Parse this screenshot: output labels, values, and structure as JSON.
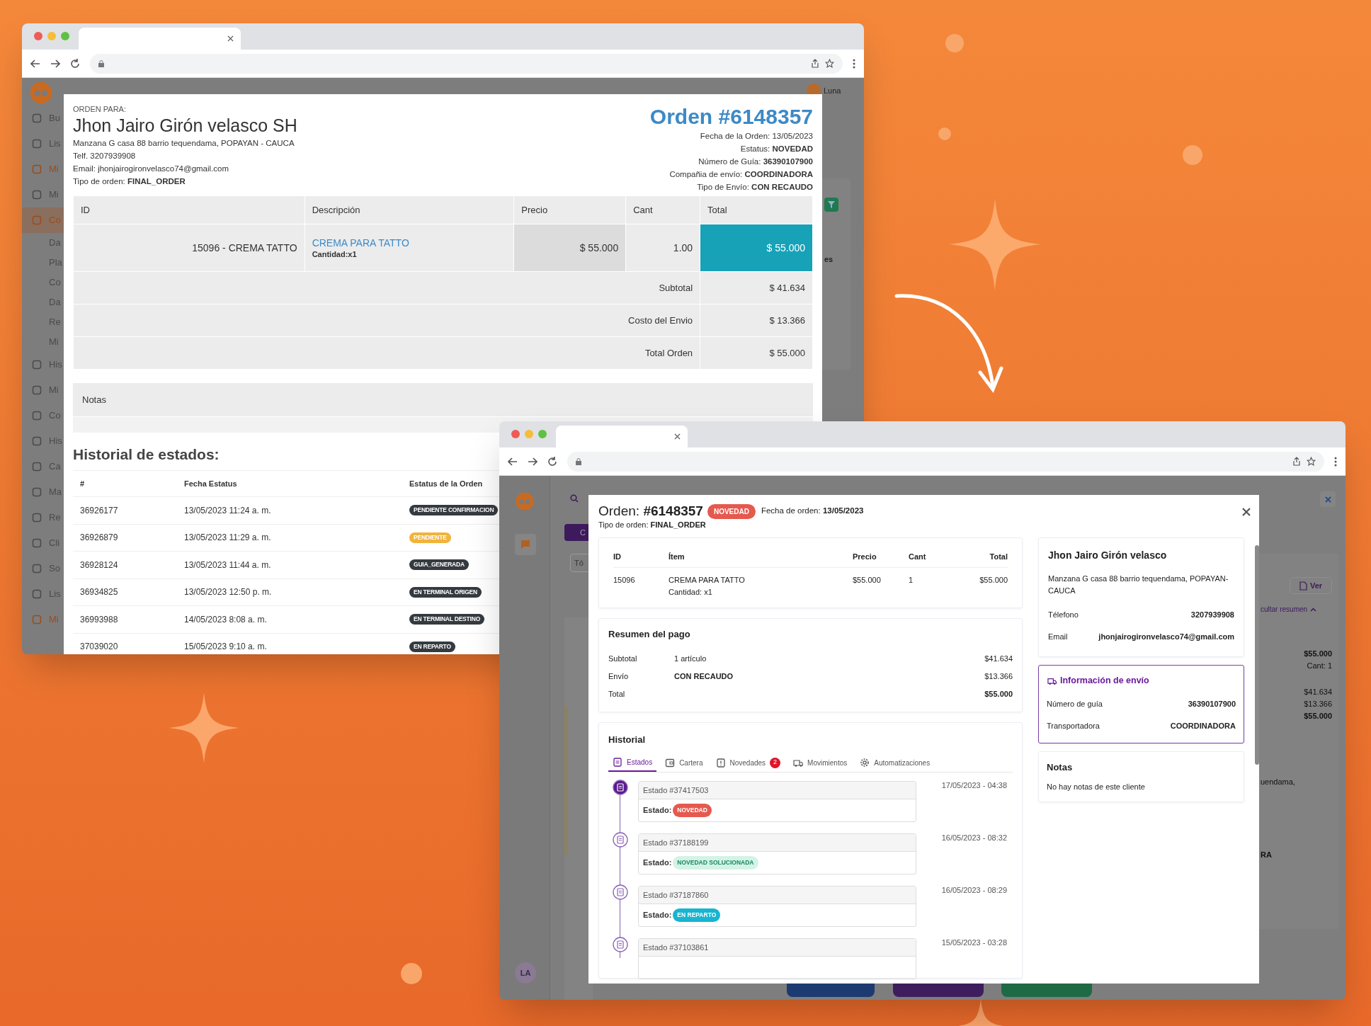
{
  "left_window": {
    "sidebar": [
      {
        "label": "Bu",
        "kind": "item",
        "color": "#4a4a4a",
        "selected": false
      },
      {
        "label": "Lis",
        "kind": "item",
        "color": "#4a4a4a",
        "selected": false
      },
      {
        "label": "Mi",
        "kind": "item",
        "color": "#9a4d1c",
        "selected": false
      },
      {
        "label": "Mi",
        "kind": "item",
        "color": "#4a4a4a",
        "selected": false
      },
      {
        "label": "Co",
        "kind": "item",
        "color": "#9a4d1c",
        "selected": true
      },
      {
        "label": "Da",
        "kind": "sub",
        "color": "#4a4a4a",
        "selected": false
      },
      {
        "label": "Pla",
        "kind": "sub",
        "color": "#4a4a4a",
        "selected": false
      },
      {
        "label": "Co",
        "kind": "sub",
        "color": "#4a4a4a",
        "selected": false
      },
      {
        "label": "Da",
        "kind": "sub",
        "color": "#4a4a4a",
        "selected": false
      },
      {
        "label": "Re",
        "kind": "sub",
        "color": "#4a4a4a",
        "selected": false
      },
      {
        "label": "Mi",
        "kind": "sub",
        "color": "#4a4a4a",
        "selected": false
      },
      {
        "label": "His",
        "kind": "item",
        "color": "#4a4a4a",
        "selected": false
      },
      {
        "label": "Mi",
        "kind": "item",
        "color": "#4a4a4a",
        "selected": false
      },
      {
        "label": "Co",
        "kind": "item",
        "color": "#4a4a4a",
        "selected": false
      },
      {
        "label": "His",
        "kind": "item",
        "color": "#4a4a4a",
        "selected": false
      },
      {
        "label": "Ca",
        "kind": "item",
        "color": "#4a4a4a",
        "selected": false
      },
      {
        "label": "Ma",
        "kind": "item",
        "color": "#4a4a4a",
        "selected": false
      },
      {
        "label": "Re",
        "kind": "item",
        "color": "#4a4a4a",
        "selected": false
      },
      {
        "label": "Cli",
        "kind": "item",
        "color": "#4a4a4a",
        "selected": false
      },
      {
        "label": "So",
        "kind": "item",
        "color": "#4a4a4a",
        "selected": false
      },
      {
        "label": "Lis",
        "kind": "item",
        "color": "#4a4a4a",
        "selected": false
      },
      {
        "label": "Mi",
        "kind": "item",
        "color": "#9a4d1c",
        "selected": false
      }
    ],
    "user": "Luna",
    "side_fragment": "es",
    "invoice": {
      "heading_label": "ORDEN PARA:",
      "customer": "Jhon Jairo Girón velasco SH",
      "address": "Manzana G casa 88 barrio tequendama, POPAYAN - CAUCA",
      "phone": "Telf. 3207939908",
      "email": "Email: jhonjairogironvelasco74@gmail.com",
      "order_type": "Tipo de orden: **FINAL_ORDER**",
      "title": "Orden #6148357",
      "details": [
        "Fecha de la Orden: 13/05/2023",
        "Estatus: **NOVEDAD**",
        "Número de Guía: **36390107900**",
        "Compañia de envío: **COORDINADORA**",
        "Tipo de Envío: **CON RECAUDO**"
      ],
      "columns": [
        "ID",
        "Descripción",
        "Precio",
        "Cant",
        "Total"
      ],
      "rows": [
        {
          "id": "15096 - CREMA TATTO",
          "description": "CREMA PARA TATTO",
          "note": "Cantidad:x1",
          "price": "$ 55.000",
          "qty": "1.00",
          "total": "$ 55.000"
        }
      ],
      "summary": [
        {
          "label": "Subtotal",
          "value": "$ 41.634"
        },
        {
          "label": "Costo del Envio",
          "value": "$ 13.366"
        },
        {
          "label": "Total Orden",
          "value": "$ 55.000"
        }
      ],
      "notes_label": "Notas",
      "history_title": "Historial de estados:",
      "history_columns": [
        "#",
        "Fecha Estatus",
        "Estatus de la Orden"
      ],
      "history": [
        {
          "id": "36926177",
          "date": "13/05/2023 11:24 a. m.",
          "status": "PENDIENTE CONFIRMACION",
          "color": "#343a40"
        },
        {
          "id": "36926879",
          "date": "13/05/2023 11:29 a. m.",
          "status": "PENDIENTE",
          "color": "#f0b43c"
        },
        {
          "id": "36928124",
          "date": "13/05/2023 11:44 a. m.",
          "status": "GUIA_GENERADA",
          "color": "#343a40"
        },
        {
          "id": "36934825",
          "date": "13/05/2023 12:50 p. m.",
          "status": "EN TERMINAL ORIGEN",
          "color": "#343a40"
        },
        {
          "id": "36993988",
          "date": "14/05/2023 8:08 a. m.",
          "status": "EN TERMINAL DESTINO",
          "color": "#343a40"
        },
        {
          "id": "37039020",
          "date": "15/05/2023 9:10 a. m.",
          "status": "EN REPARTO",
          "color": "#343a40"
        }
      ]
    }
  },
  "right_window": {
    "avatar": "LA",
    "button_fragment": "C",
    "field_fragment": "Tó",
    "panel": {
      "view_button": "Ver",
      "toggle": "cultar resumen",
      "price": "$55.000",
      "qty": "Cant: 1",
      "totals": [
        "$41.634",
        "$13.366",
        "$55.000"
      ],
      "address_fragment": "uendama,",
      "carrier_fragment": "RA"
    },
    "modal": {
      "title_label": "Orden:",
      "order_number": "#6148357",
      "status": "NOVEDAD",
      "date": "Fecha de orden: **13/05/2023**",
      "order_type": "Tipo de orden: **FINAL_ORDER**",
      "item_columns": [
        "ID",
        "Ítem",
        "Precio",
        "Cant",
        "Total"
      ],
      "items": [
        {
          "id": "15096",
          "item": "CREMA PARA TATTO",
          "note": "Cantidad: x1",
          "price": "$55.000",
          "qty": "1",
          "total": "$55.000"
        }
      ],
      "payment": {
        "title": "Resumen del pago",
        "rows": [
          {
            "label": "Subtotal",
            "detail": "1 artículo",
            "value": "$41.634"
          },
          {
            "label": "Envío",
            "detail": "CON RECAUDO",
            "value": "$13.366"
          },
          {
            "label": "Total",
            "value": "$55.000"
          }
        ]
      },
      "history": {
        "title": "Historial",
        "tabs": [
          {
            "label": "Estados",
            "selected": true,
            "kind": "clipboard"
          },
          {
            "label": "Cartera",
            "selected": false,
            "kind": "wallet"
          },
          {
            "label": "Novedades",
            "selected": false,
            "kind": "alert",
            "count": "2"
          },
          {
            "label": "Movimientos",
            "selected": false,
            "kind": "truck"
          },
          {
            "label": "Automatizaciones",
            "selected": false,
            "kind": "gear"
          }
        ],
        "entries": [
          {
            "title": "Estado #37417503",
            "label": "Estado:",
            "status": "NOVEDAD",
            "color": "#e5594f",
            "date": "17/05/2023 - 04:38",
            "active": true
          },
          {
            "title": "Estado #37188199",
            "label": "Estado:",
            "status": "NOVEDAD SOLUCIONADA",
            "color": "#d4f3e6",
            "date": "16/05/2023 - 08:32",
            "active": false
          },
          {
            "title": "Estado #37187860",
            "label": "Estado:",
            "status": "EN REPARTO",
            "color": "#17b5d0",
            "date": "16/05/2023 - 08:29",
            "active": false
          },
          {
            "title": "Estado #37103861",
            "date": "15/05/2023 - 03:28",
            "active": false
          }
        ]
      },
      "customer": {
        "name": "Jhon Jairo Girón velasco",
        "address": "Manzana G casa 88 barrio tequendama, POPAYAN-CAUCA",
        "rows": [
          {
            "label": "Télefono",
            "value": "3207939908"
          },
          {
            "label": "Email",
            "value": "jhonjairogironvelasco74@gmail.com"
          }
        ]
      },
      "shipping": {
        "title": "Información de envío",
        "rows": [
          {
            "label": "Número de guía",
            "value": "36390107900"
          },
          {
            "label": "Transportadora",
            "value": "COORDINADORA"
          }
        ]
      },
      "notes": {
        "title": "Notas",
        "text": "No hay notas de este cliente"
      }
    }
  }
}
